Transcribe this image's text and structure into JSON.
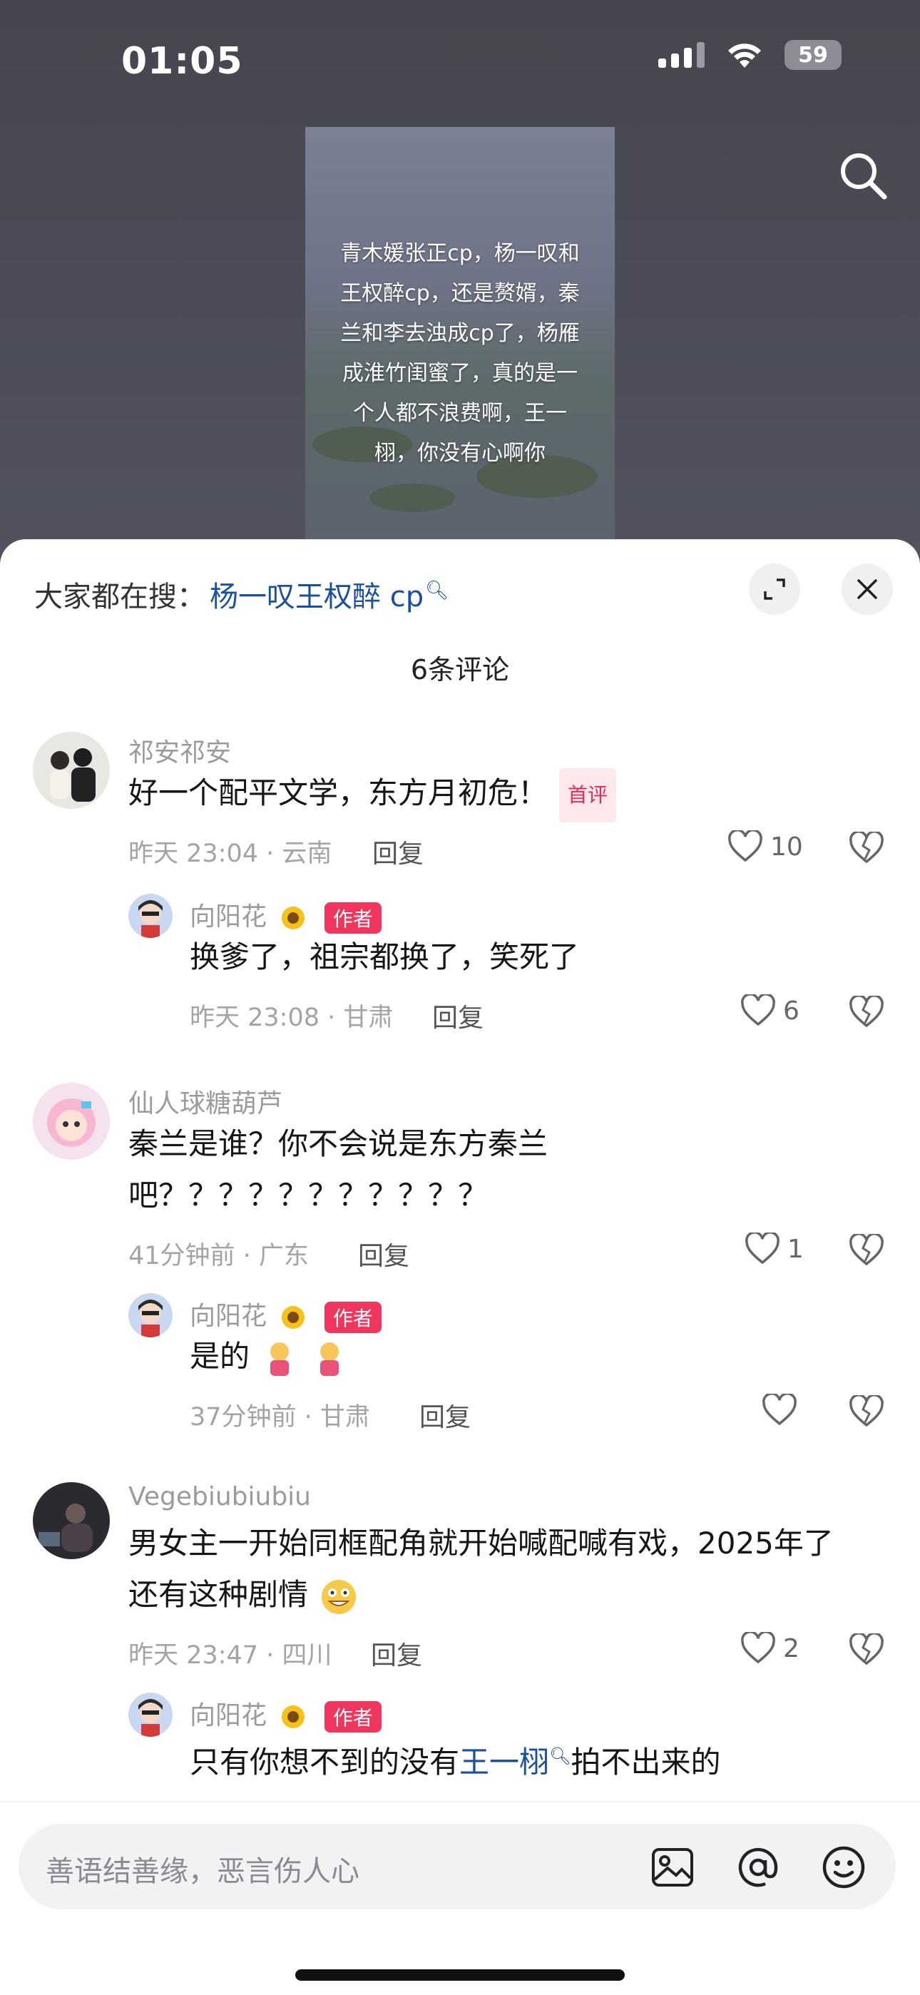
{
  "status_bar": {
    "time": "01:05",
    "battery": "59"
  },
  "video": {
    "caption": "青木媛张正cp，杨一叹和王权醉cp，还是赘婿，秦兰和李去浊成cp了，杨雁成淮竹闺蜜了，真的是一个人都不浪费啊，王一栩，你没有心啊你"
  },
  "sheet": {
    "hot_search_label": "大家都在搜：",
    "hot_search_query": "杨一叹王权醉 cp",
    "comment_count": "6条评论"
  },
  "comments": [
    {
      "user": "祁安祁安",
      "text": "好一个配平文学，东方月初危！",
      "badge": "首评",
      "meta": "昨天 23:04 · 云南",
      "reply": "回复",
      "likes": "10",
      "replies": [
        {
          "user": "向阳花",
          "tag": "作者",
          "text": "换爹了，祖宗都换了，笑死了",
          "meta": "昨天 23:08 · 甘肃",
          "reply": "回复",
          "likes": "6"
        }
      ]
    },
    {
      "user": "仙人球糖葫芦",
      "text_line1": "秦兰是谁？你不会说是东方秦兰",
      "text_line2": "吧？？？？？？？？？？？",
      "meta": "41分钟前 · 广东",
      "reply": "回复",
      "likes": "1",
      "replies": [
        {
          "user": "向阳花",
          "tag": "作者",
          "text": "是的",
          "meta": "37分钟前 · 甘肃",
          "reply": "回复",
          "likes": ""
        }
      ]
    },
    {
      "user": "Vegebiubiubiu",
      "text_line1": "男女主一开始同框配角就开始喊配喊有戏，2025年了",
      "text_line2": "还有这种剧情",
      "meta": "昨天 23:47 · 四川",
      "reply": "回复",
      "likes": "2",
      "replies": [
        {
          "user": "向阳花",
          "tag": "作者",
          "text_before": "只有你想不到的没有",
          "link": "王一栩",
          "text_after": "拍不出来的"
        }
      ]
    }
  ],
  "input": {
    "placeholder": "善语结善缘，恶言伤人心"
  },
  "icons": [
    "search-icon",
    "expand-icon",
    "close-icon",
    "heart-icon",
    "broken-heart-icon",
    "image-icon",
    "at-icon",
    "emoji-icon",
    "sunflower-icon"
  ],
  "colors": {
    "link": "#1b4fa0",
    "author_tag": "#f0365c",
    "first_badge_text": "#e42d56"
  }
}
